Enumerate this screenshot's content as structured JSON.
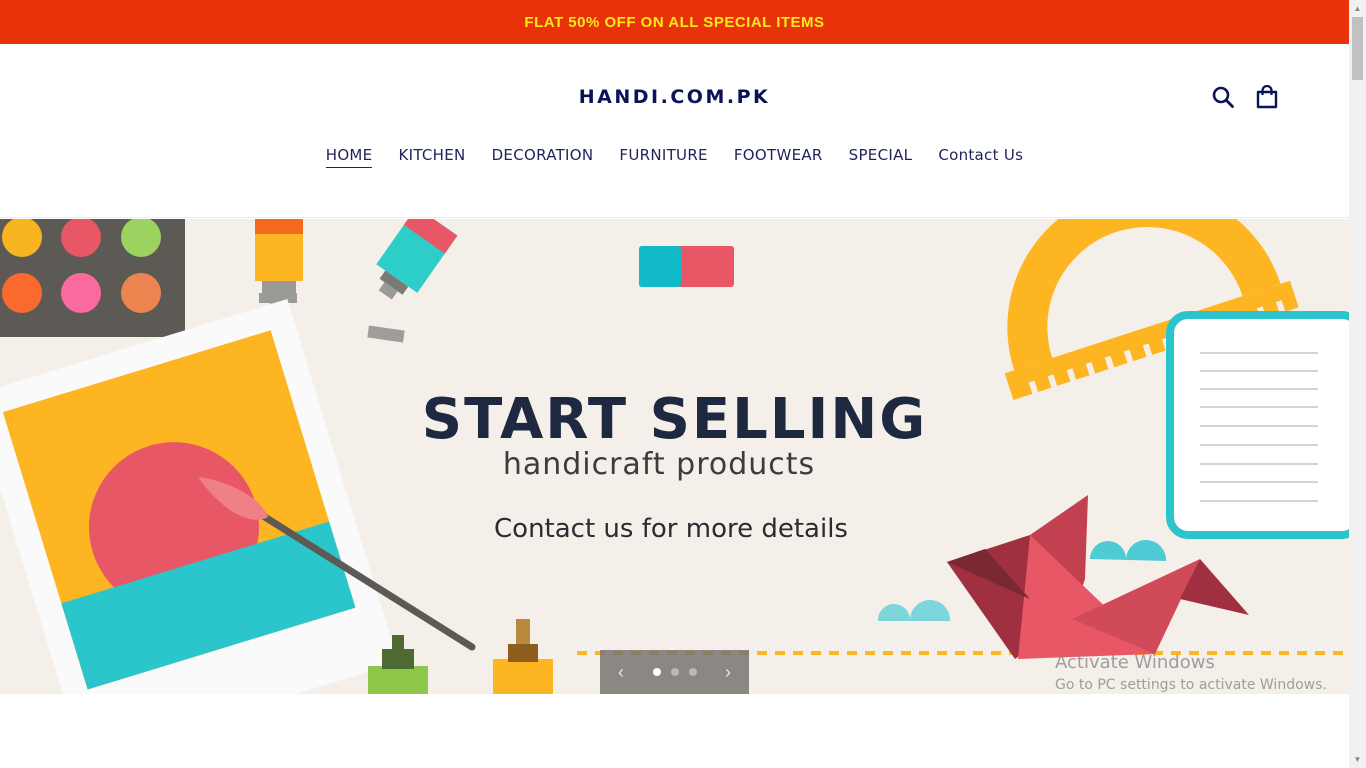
{
  "announcement": "FLAT 50% OFF ON ALL SPECIAL ITEMS",
  "brand": "HANDI.COM.PK",
  "icons": {
    "search": "search-icon",
    "cart": "cart-icon"
  },
  "nav": [
    "HOME",
    "KITCHEN",
    "DECORATION",
    "FURNITURE",
    "FOOTWEAR",
    "SPECIAL",
    "Contact Us"
  ],
  "active_nav": "HOME",
  "hero": {
    "title": "START SELLING",
    "subtitle": "handicraft products",
    "cta": "Contact us for more details"
  },
  "slider": {
    "slides": 3,
    "current": 1,
    "prev": "‹",
    "next": "›"
  },
  "watermark": {
    "line1": "Activate Windows",
    "line2": "Go to PC settings to activate Windows."
  },
  "colors": {
    "announce_bg": "#e8330a",
    "announce_text": "#ffe81a",
    "brand": "#0b1357",
    "hero_bg": "#f5efe9"
  }
}
